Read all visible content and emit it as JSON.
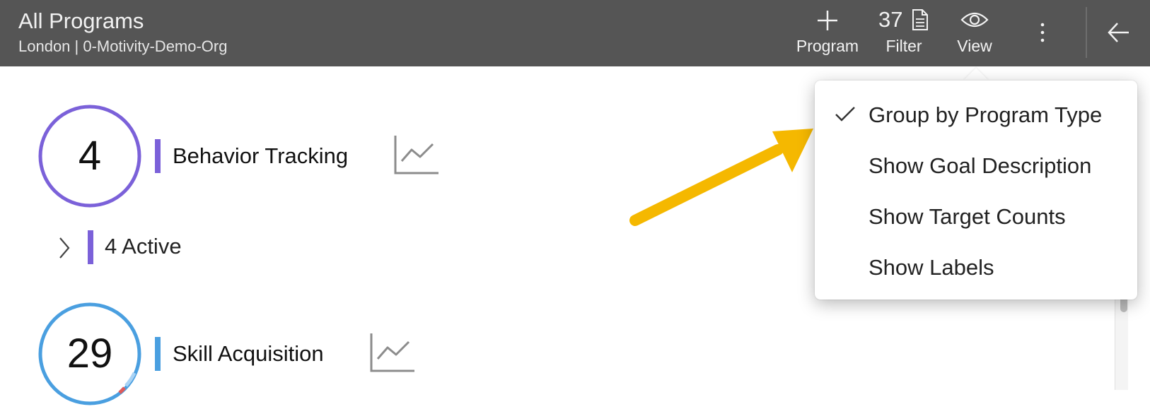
{
  "header": {
    "title": "All Programs",
    "subtitle": "London | 0-Motivity-Demo-Org",
    "program_label": "Program",
    "filter_count": "37",
    "filter_label": "Filter",
    "view_label": "View",
    "icons": {
      "program": "plus-icon",
      "filter": "document-icon",
      "view": "eye-icon",
      "more": "vertical-ellipsis-icon",
      "back": "arrow-left-icon"
    }
  },
  "groups": [
    {
      "count": "4",
      "name": "Behavior Tracking",
      "color": "#7b61d9",
      "active_label": "4 Active"
    },
    {
      "count": "29",
      "name": "Skill Acquisition",
      "color": "#4a9fe0"
    }
  ],
  "view_menu": {
    "items": [
      {
        "label": "Group by Program Type",
        "checked": true
      },
      {
        "label": "Show Goal Description",
        "checked": false
      },
      {
        "label": "Show Target Counts",
        "checked": false
      },
      {
        "label": "Show Labels",
        "checked": false
      }
    ]
  },
  "colors": {
    "header_bg": "#555555",
    "annotation_arrow": "#f5b800"
  }
}
